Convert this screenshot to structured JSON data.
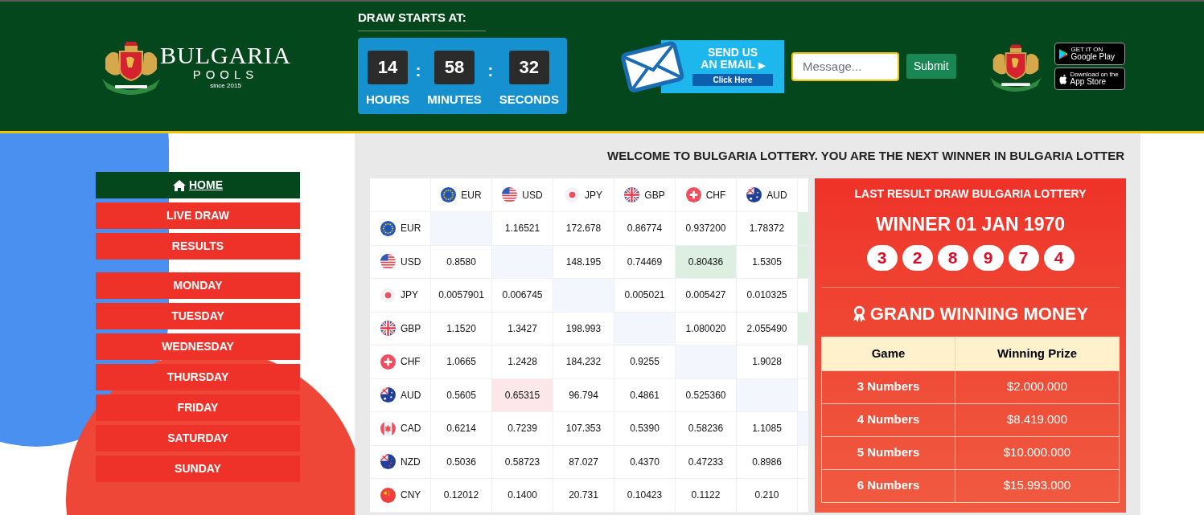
{
  "header": {
    "logo": {
      "title": "BULGARIA",
      "subtitle": "POOLS",
      "since": "since 2015"
    },
    "countdown": {
      "title": "DRAW STARTS AT:",
      "separator": ":",
      "units": [
        {
          "value": "14",
          "label": "HOURS"
        },
        {
          "value": "58",
          "label": "MINUTES"
        },
        {
          "value": "32",
          "label": "SECONDS"
        }
      ]
    },
    "email_banner": {
      "line_1": "SEND US",
      "line_2": "AN EMAIL",
      "arrow": "▶",
      "button": "Click Here"
    },
    "message": {
      "placeholder": "Message..."
    },
    "submit": "Submit",
    "stores": [
      {
        "kind": "google",
        "small": "GET IT ON",
        "big": "Google Play"
      },
      {
        "kind": "apple",
        "small": "Download on the",
        "big": "App Store"
      }
    ]
  },
  "menu": {
    "groups": [
      [
        {
          "label": "HOME",
          "selected": true
        },
        {
          "label": "LIVE DRAW",
          "selected": false
        },
        {
          "label": "RESULTS",
          "selected": false
        }
      ],
      [
        {
          "label": "MONDAY",
          "selected": false
        },
        {
          "label": "TUESDAY",
          "selected": false
        },
        {
          "label": "WEDNESDAY",
          "selected": false
        },
        {
          "label": "THURSDAY",
          "selected": false
        },
        {
          "label": "FRIDAY",
          "selected": false
        },
        {
          "label": "SATURDAY",
          "selected": false
        },
        {
          "label": "SUNDAY",
          "selected": false
        }
      ]
    ]
  },
  "ticker": "WELCOME TO BULGARIA LOTTERY. YOU ARE THE NEXT WINNER IN BULGARIA LOTTER",
  "rates": {
    "columns": [
      {
        "code": "EUR",
        "kind": "eu"
      },
      {
        "code": "USD",
        "kind": "us"
      },
      {
        "code": "JPY",
        "kind": "jp"
      },
      {
        "code": "GBP",
        "kind": "gb"
      },
      {
        "code": "CHF",
        "kind": "ch"
      },
      {
        "code": "AUD",
        "kind": "au"
      }
    ],
    "rows": [
      {
        "code": "EUR",
        "kind": "eu",
        "cells": [
          {
            "kind": "same"
          },
          {
            "value": "1.16521",
            "kind": "plain"
          },
          {
            "value": "172.678",
            "kind": "plain"
          },
          {
            "value": "0.86774",
            "kind": "plain"
          },
          {
            "value": "0.937200",
            "kind": "plain"
          },
          {
            "value": "1.78372",
            "kind": "plain"
          },
          {
            "kind": "up"
          }
        ]
      },
      {
        "code": "USD",
        "kind": "us",
        "cells": [
          {
            "value": "0.8580",
            "kind": "plain"
          },
          {
            "kind": "same"
          },
          {
            "value": "148.195",
            "kind": "plain"
          },
          {
            "value": "0.74469",
            "kind": "plain"
          },
          {
            "value": "0.80436",
            "kind": "up"
          },
          {
            "value": "1.5305",
            "kind": "plain"
          },
          {
            "kind": "up"
          }
        ]
      },
      {
        "code": "JPY",
        "kind": "jp",
        "cells": [
          {
            "value": "0.0057901",
            "kind": "plain"
          },
          {
            "value": "0.006745",
            "kind": "plain"
          },
          {
            "kind": "same"
          },
          {
            "value": "0.005021",
            "kind": "plain"
          },
          {
            "value": "0.005427",
            "kind": "plain"
          },
          {
            "value": "0.010325",
            "kind": "plain"
          },
          {
            "kind": "plain"
          }
        ]
      },
      {
        "code": "GBP",
        "kind": "gb",
        "cells": [
          {
            "value": "1.1520",
            "kind": "plain"
          },
          {
            "value": "1.3427",
            "kind": "plain"
          },
          {
            "value": "198.993",
            "kind": "plain"
          },
          {
            "kind": "same"
          },
          {
            "value": "1.080020",
            "kind": "plain"
          },
          {
            "value": "2.055490",
            "kind": "plain"
          },
          {
            "kind": "up"
          }
        ]
      },
      {
        "code": "CHF",
        "kind": "ch",
        "cells": [
          {
            "value": "1.0665",
            "kind": "plain"
          },
          {
            "value": "1.2428",
            "kind": "plain"
          },
          {
            "value": "184.232",
            "kind": "plain"
          },
          {
            "value": "0.9255",
            "kind": "plain"
          },
          {
            "kind": "same"
          },
          {
            "value": "1.9028",
            "kind": "plain"
          },
          {
            "kind": "plain"
          }
        ]
      },
      {
        "code": "AUD",
        "kind": "au",
        "cells": [
          {
            "value": "0.5605",
            "kind": "plain"
          },
          {
            "value": "0.65315",
            "kind": "down"
          },
          {
            "value": "96.794",
            "kind": "plain"
          },
          {
            "value": "0.4861",
            "kind": "plain"
          },
          {
            "value": "0.525360",
            "kind": "plain"
          },
          {
            "kind": "same"
          },
          {
            "kind": "plain"
          }
        ]
      },
      {
        "code": "CAD",
        "kind": "ca",
        "cells": [
          {
            "value": "0.6214",
            "kind": "plain"
          },
          {
            "value": "0.7239",
            "kind": "plain"
          },
          {
            "value": "107.353",
            "kind": "plain"
          },
          {
            "value": "0.5390",
            "kind": "plain"
          },
          {
            "value": "0.58236",
            "kind": "plain"
          },
          {
            "value": "1.1085",
            "kind": "plain"
          },
          {
            "kind": "same"
          }
        ]
      },
      {
        "code": "NZD",
        "kind": "nz",
        "cells": [
          {
            "value": "0.5036",
            "kind": "plain"
          },
          {
            "value": "0.58723",
            "kind": "plain"
          },
          {
            "value": "87.027",
            "kind": "plain"
          },
          {
            "value": "0.4370",
            "kind": "plain"
          },
          {
            "value": "0.47233",
            "kind": "plain"
          },
          {
            "value": "0.8986",
            "kind": "plain"
          },
          {
            "kind": "plain"
          }
        ]
      },
      {
        "code": "CNY",
        "kind": "cn",
        "cells": [
          {
            "value": "0.12012",
            "kind": "plain"
          },
          {
            "value": "0.1400",
            "kind": "plain"
          },
          {
            "value": "20.731",
            "kind": "plain"
          },
          {
            "value": "0.10423",
            "kind": "plain"
          },
          {
            "value": "0.1122",
            "kind": "plain"
          },
          {
            "value": "0.210",
            "kind": "plain"
          },
          {
            "kind": "plain"
          }
        ]
      }
    ]
  },
  "result": {
    "title": "LAST RESULT DRAW BULGARIA LOTTERY",
    "winner": "WINNER 01 JAN 1970",
    "numbers": [
      "3",
      "2",
      "8",
      "9",
      "7",
      "4"
    ],
    "prize_title": "GRAND WINNING MONEY",
    "columns": [
      "Game",
      "Winning Prize"
    ],
    "rows": [
      [
        "3 Numbers",
        "$2.000.000"
      ],
      [
        "4 Numbers",
        "$8.419.000"
      ],
      [
        "5 Numbers",
        "$10.000.000"
      ],
      [
        "6 Numbers",
        "$15.993.000"
      ]
    ]
  }
}
